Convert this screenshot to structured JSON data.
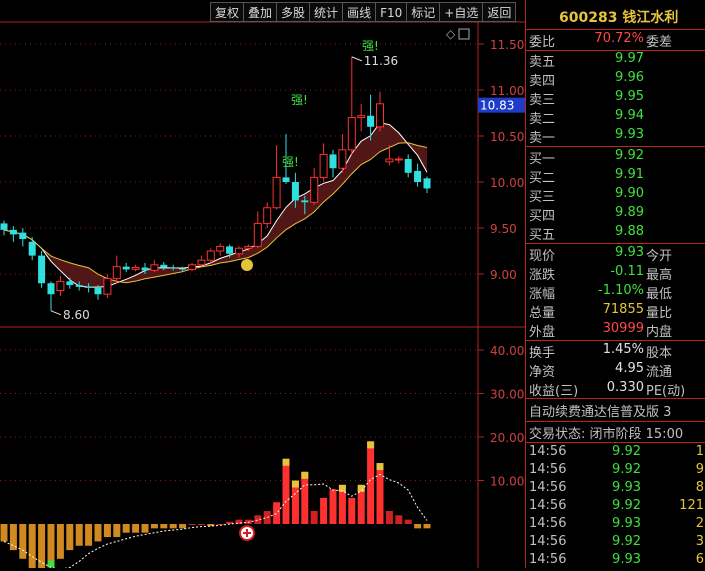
{
  "toolbar": [
    "复权",
    "叠加",
    "多股",
    "统计",
    "画线",
    "F10",
    "标记",
    "+自选",
    "返回"
  ],
  "price_axis": [
    "11.50",
    "11.00",
    "10.50",
    "10.00",
    "9.50",
    "9.00"
  ],
  "vol_axis": [
    "40.00",
    "30.00",
    "20.00",
    "10.00"
  ],
  "current_price_tag": "10.83",
  "annotations": {
    "high": "11.36",
    "low": "8.60",
    "strong": "强!",
    "diamond": "◇"
  },
  "colors": {
    "up": "#ff3030",
    "down": "#30e0e0",
    "ma_fill": "#5a1818",
    "ma_fill2": "#1f4a4a",
    "yellow": "#e6c43a",
    "green": "#3fe03f",
    "frame": "#b22222"
  },
  "quote": {
    "title": "600283 钱江水利",
    "weibi_label": "委比",
    "weibi_value": "70.72%",
    "weicha_label": "委差",
    "asks": [
      {
        "label": "卖五",
        "price": "9.97"
      },
      {
        "label": "卖四",
        "price": "9.96"
      },
      {
        "label": "卖三",
        "price": "9.95"
      },
      {
        "label": "卖二",
        "price": "9.94"
      },
      {
        "label": "卖一",
        "price": "9.93"
      }
    ],
    "bids": [
      {
        "label": "买一",
        "price": "9.92"
      },
      {
        "label": "买二",
        "price": "9.91"
      },
      {
        "label": "买三",
        "price": "9.90"
      },
      {
        "label": "买四",
        "price": "9.89"
      },
      {
        "label": "买五",
        "price": "9.88"
      }
    ],
    "stats": [
      {
        "label": "现价",
        "value": "9.93",
        "right": "今开",
        "color": "green"
      },
      {
        "label": "涨跌",
        "value": "-0.11",
        "right": "最高",
        "color": "green"
      },
      {
        "label": "涨幅",
        "value": "-1.10%",
        "right": "最低",
        "color": "green"
      },
      {
        "label": "总量",
        "value": "71855",
        "right": "量比",
        "color": "yellow"
      },
      {
        "label": "外盘",
        "value": "30999",
        "right": "内盘",
        "color": "red"
      }
    ],
    "stats2": [
      {
        "label": "换手",
        "value": "1.45%",
        "right": "股本"
      },
      {
        "label": "净资",
        "value": "4.95",
        "right": "流通"
      },
      {
        "label": "收益(三)",
        "value": "0.330",
        "right": "PE(动)"
      }
    ],
    "banner": "自动续费通达信普及版 3",
    "status": "交易状态: 闭市阶段 15:00",
    "ticks": [
      {
        "time": "14:56",
        "price": "9.92",
        "vol": "1"
      },
      {
        "time": "14:56",
        "price": "9.92",
        "vol": "9"
      },
      {
        "time": "14:56",
        "price": "9.93",
        "vol": "8"
      },
      {
        "time": "14:56",
        "price": "9.92",
        "vol": "121"
      },
      {
        "time": "14:56",
        "price": "9.93",
        "vol": "2"
      },
      {
        "time": "14:56",
        "price": "9.92",
        "vol": "3"
      },
      {
        "time": "14:56",
        "price": "9.93",
        "vol": "6"
      }
    ]
  },
  "chart_data": {
    "type": "candlestick",
    "candles": [
      [
        9.55,
        9.48,
        9.58,
        9.42
      ],
      [
        9.48,
        9.43,
        9.52,
        9.35
      ],
      [
        9.45,
        9.38,
        9.5,
        9.3
      ],
      [
        9.35,
        9.2,
        9.4,
        9.15
      ],
      [
        9.2,
        8.9,
        9.25,
        8.85
      ],
      [
        8.9,
        8.78,
        8.92,
        8.6
      ],
      [
        8.82,
        8.92,
        8.98,
        8.76
      ],
      [
        8.92,
        8.88,
        8.96,
        8.84
      ],
      [
        8.88,
        8.86,
        8.92,
        8.82
      ],
      [
        8.86,
        8.85,
        8.9,
        8.8
      ],
      [
        8.85,
        8.78,
        8.88,
        8.72
      ],
      [
        8.78,
        8.95,
        9.0,
        8.74
      ],
      [
        8.95,
        9.08,
        9.2,
        8.9
      ],
      [
        9.08,
        9.05,
        9.12,
        9.02
      ],
      [
        9.05,
        9.07,
        9.1,
        9.03
      ],
      [
        9.07,
        9.04,
        9.12,
        9.0
      ],
      [
        9.04,
        9.1,
        9.15,
        9.02
      ],
      [
        9.1,
        9.07,
        9.13,
        9.04
      ],
      [
        9.07,
        9.06,
        9.1,
        9.04
      ],
      [
        9.06,
        9.05,
        9.08,
        9.02
      ],
      [
        9.05,
        9.1,
        9.12,
        9.03
      ],
      [
        9.1,
        9.15,
        9.2,
        9.08
      ],
      [
        9.15,
        9.25,
        9.28,
        9.12
      ],
      [
        9.25,
        9.3,
        9.33,
        9.2
      ],
      [
        9.3,
        9.22,
        9.32,
        9.18
      ],
      [
        9.22,
        9.28,
        9.3,
        9.18
      ],
      [
        9.28,
        9.3,
        9.32,
        9.25
      ],
      [
        9.3,
        9.55,
        9.68,
        9.28
      ],
      [
        9.55,
        9.72,
        9.78,
        9.5
      ],
      [
        9.72,
        10.05,
        10.4,
        9.7
      ],
      [
        10.05,
        10.0,
        10.52,
        9.98
      ],
      [
        10.0,
        9.8,
        10.1,
        9.72
      ],
      [
        9.8,
        9.78,
        9.85,
        9.65
      ],
      [
        9.78,
        10.05,
        10.15,
        9.75
      ],
      [
        10.05,
        10.3,
        10.42,
        10.0
      ],
      [
        10.3,
        10.15,
        10.35,
        10.05
      ],
      [
        10.15,
        10.35,
        10.52,
        10.1
      ],
      [
        10.35,
        10.7,
        11.36,
        10.3
      ],
      [
        10.7,
        10.72,
        10.85,
        10.55
      ],
      [
        10.72,
        10.6,
        10.95,
        10.45
      ],
      [
        10.6,
        10.85,
        10.98,
        10.55
      ],
      [
        10.22,
        10.25,
        10.4,
        10.18
      ],
      [
        10.24,
        10.25,
        10.28,
        10.2
      ],
      [
        10.25,
        10.1,
        10.3,
        10.05
      ],
      [
        10.12,
        10.0,
        10.2,
        9.95
      ],
      [
        10.04,
        9.93,
        10.06,
        9.88
      ]
    ],
    "volume": [
      -4,
      -6,
      -8,
      -12,
      -14,
      -10,
      -8,
      -6,
      -5,
      -5,
      -4,
      -3,
      -3,
      -2,
      -2,
      -2,
      -1,
      -1,
      -1,
      -1,
      0,
      0,
      -0.5,
      0,
      0.5,
      1,
      1,
      2,
      3,
      5,
      15,
      10,
      12,
      3,
      6,
      8,
      9,
      6,
      9,
      19,
      14,
      3,
      2,
      1,
      -1,
      -1
    ]
  }
}
